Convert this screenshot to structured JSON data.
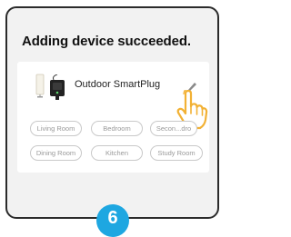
{
  "screen": {
    "title": "Adding device succeeded."
  },
  "device": {
    "name": "Outdoor SmartPlug",
    "icons": [
      "lamp-icon",
      "smart-plug-icon",
      "edit-pencil-icon",
      "pointing-hand-icon"
    ]
  },
  "rooms": [
    {
      "label": "Living Room"
    },
    {
      "label": "Bedroom"
    },
    {
      "label": "Secon...dro"
    },
    {
      "label": "Dining Room"
    },
    {
      "label": "Kitchen"
    },
    {
      "label": "Study Room"
    }
  ],
  "step_badge": {
    "number": "6"
  },
  "colors": {
    "accent": "#1ea7e1",
    "hand": "#f2b134",
    "frame": "#2b2b2b",
    "chip_border": "#c9c9c9",
    "chip_text": "#9a9a9a"
  }
}
